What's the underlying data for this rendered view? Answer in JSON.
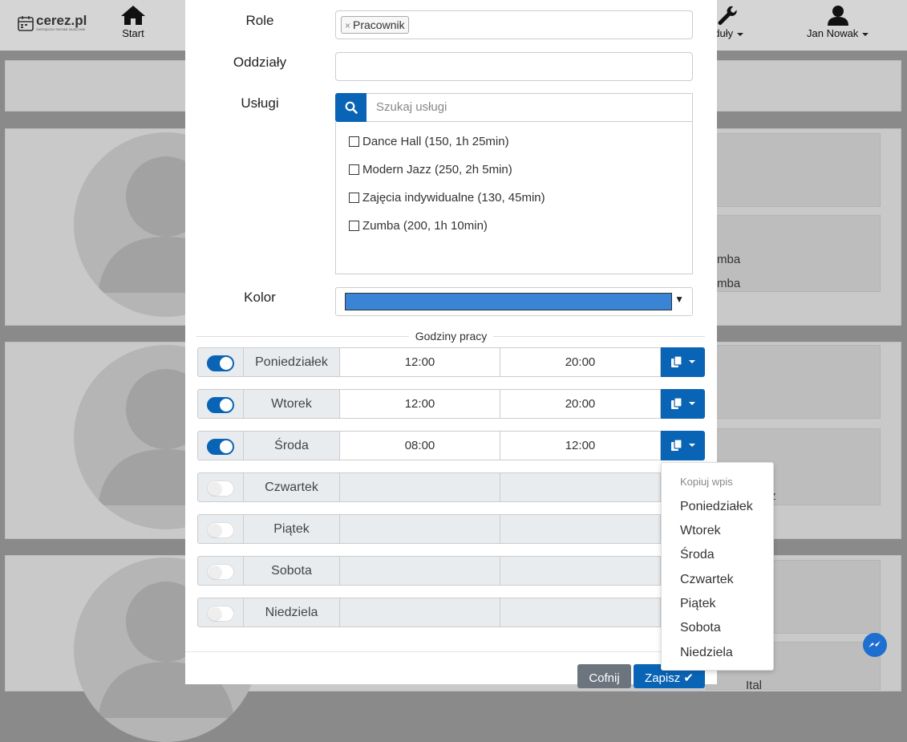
{
  "app": {
    "logo_text": "cerez.pl",
    "logo_tagline": "ZARZĄDZAJ SWOIMI ZAJĘCIAMI",
    "nav": {
      "start": "Start",
      "modules": "oduły",
      "user": "Jan Nowak"
    },
    "background_texts": [
      "mba",
      "mba",
      "z",
      "Ital"
    ]
  },
  "form": {
    "role_label": "Role",
    "role_chip": "Pracownik",
    "role_chip_remove": "×",
    "branches_label": "Oddziały",
    "services_label": "Usługi",
    "services_search_placeholder": "Szukaj usługi",
    "services": [
      {
        "label": "Dance Hall (150, 1h 25min)",
        "checked": false
      },
      {
        "label": "Modern Jazz (250, 2h 5min)",
        "checked": false
      },
      {
        "label": "Zajęcia indywidualne (130, 45min)",
        "checked": false
      },
      {
        "label": "Zumba (200, 1h 10min)",
        "checked": false
      }
    ],
    "color_label": "Kolor",
    "color_value": "#3a84d5",
    "color_arrow": "▼"
  },
  "hours": {
    "title": "Godziny pracy",
    "days": [
      {
        "day": "Poniedziałek",
        "enabled": true,
        "from": "12:00",
        "to": "20:00"
      },
      {
        "day": "Wtorek",
        "enabled": true,
        "from": "12:00",
        "to": "20:00"
      },
      {
        "day": "Środa",
        "enabled": true,
        "from": "08:00",
        "to": "12:00"
      },
      {
        "day": "Czwartek",
        "enabled": false,
        "from": "",
        "to": ""
      },
      {
        "day": "Piątek",
        "enabled": false,
        "from": "",
        "to": ""
      },
      {
        "day": "Sobota",
        "enabled": false,
        "from": "",
        "to": ""
      },
      {
        "day": "Niedziela",
        "enabled": false,
        "from": "",
        "to": ""
      }
    ]
  },
  "copy_menu": {
    "header": "Kopiuj wpis",
    "items": [
      "Poniedziałek",
      "Wtorek",
      "Środa",
      "Czwartek",
      "Piątek",
      "Sobota",
      "Niedziela"
    ]
  },
  "footer": {
    "back_label": "Cofnij",
    "save_label": "Zapisz ✔"
  },
  "colors": {
    "primary": "#0a64b5",
    "secondary": "#6c757d"
  }
}
